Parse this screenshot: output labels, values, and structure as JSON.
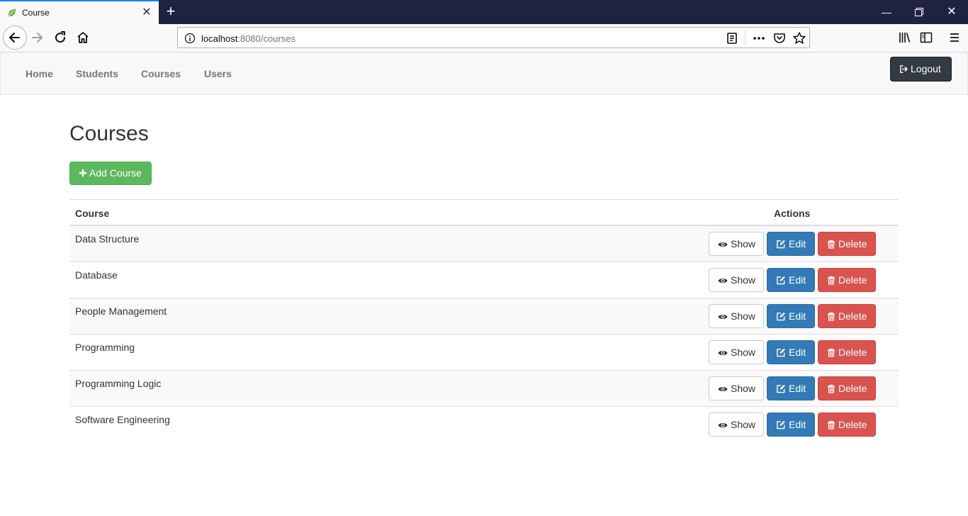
{
  "browser": {
    "tab_title": "Course",
    "url_host": "localhost",
    "url_path": ":8080/courses"
  },
  "navbar": {
    "links": [
      "Home",
      "Students",
      "Courses",
      "Users"
    ],
    "logout_label": "Logout"
  },
  "page": {
    "title": "Courses",
    "add_button_label": "Add Course"
  },
  "table": {
    "headers": {
      "course": "Course",
      "actions": "Actions"
    },
    "rows": [
      {
        "course": "Data Structure"
      },
      {
        "course": "Database"
      },
      {
        "course": "People Management"
      },
      {
        "course": "Programming"
      },
      {
        "course": "Programming Logic"
      },
      {
        "course": "Software Engineering"
      }
    ],
    "actions": {
      "show": "Show",
      "edit": "Edit",
      "delete": "Delete"
    }
  },
  "colors": {
    "primary": "#337ab7",
    "success": "#5cb85c",
    "danger": "#d9534f",
    "dark": "#333a40"
  },
  "icons": {
    "logout": "sign-out-icon",
    "add": "plus-icon",
    "show": "eye-icon",
    "edit": "edit-icon",
    "delete": "trash-icon"
  }
}
